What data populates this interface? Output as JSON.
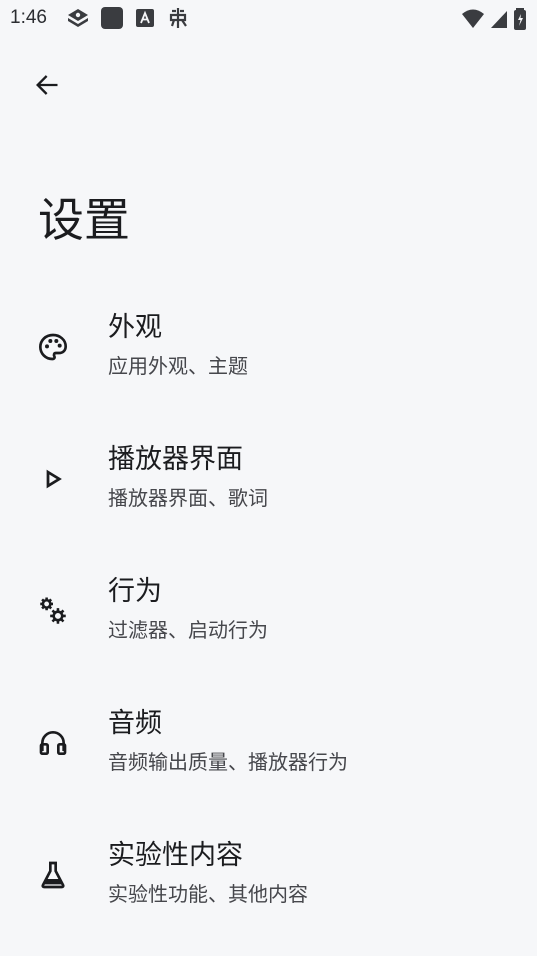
{
  "status_bar": {
    "time": "1:46",
    "left_icons": [
      "stack-icon",
      "app-square-icon",
      "keyboard-a-icon",
      "bug-icon"
    ],
    "right_icons": [
      "wifi-icon",
      "signal-icon",
      "battery-charging-icon"
    ]
  },
  "header": {
    "back_icon": "arrow-left-icon",
    "title": "设置"
  },
  "settings": {
    "items": [
      {
        "icon": "palette-icon",
        "title": "外观",
        "subtitle": "应用外观、主题"
      },
      {
        "icon": "play-outline-icon",
        "title": "播放器界面",
        "subtitle": "播放器界面、歌词"
      },
      {
        "icon": "gears-icon",
        "title": "行为",
        "subtitle": "过滤器、启动行为"
      },
      {
        "icon": "headphones-icon",
        "title": "音频",
        "subtitle": "音频输出质量、播放器行为"
      },
      {
        "icon": "flask-icon",
        "title": "实验性内容",
        "subtitle": "实验性功能、其他内容"
      }
    ]
  },
  "colors": {
    "background": "#f6f7f9",
    "text_primary": "#1b1c1f",
    "text_secondary": "#46474c"
  }
}
